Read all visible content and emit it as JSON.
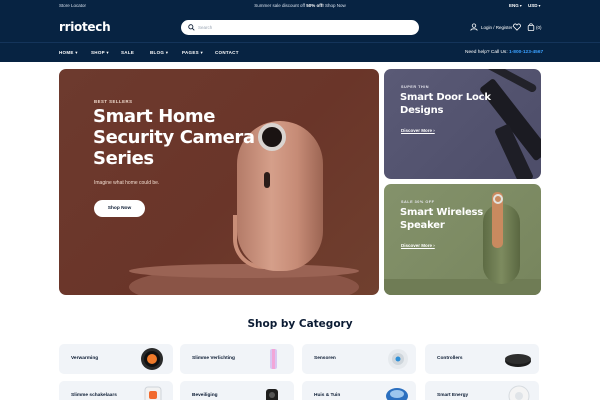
{
  "topbar": {
    "store_locator": "Store Locator",
    "promo_prefix": "Summer sale discount off ",
    "promo_bold": "50% off!",
    "promo_link": " Shop Now",
    "language": "ENG",
    "currency": "USD"
  },
  "header": {
    "logo": "rriotech",
    "search_placeholder": "Search",
    "login_label": "Login / Register",
    "cart_count": "(0)"
  },
  "nav": {
    "items": [
      "HOME",
      "SHOP",
      "SALE",
      "BLOG",
      "PAGES",
      "CONTACT"
    ],
    "help_label": "Need help? Call Us:",
    "help_phone": "1-800-123-4567"
  },
  "hero": {
    "eyebrow": "BEST SELLERS",
    "title": "Smart Home Security Camera Series",
    "subtitle": "Imagine what home could be.",
    "button": "Shop Now"
  },
  "side_banners": [
    {
      "eyebrow": "SUPER THIN",
      "title": "Smart Door Lock Designs",
      "link": "Discover More"
    },
    {
      "eyebrow": "SALE 30% OFF",
      "title": "Smart Wireless Speaker",
      "link": "Discover More"
    }
  ],
  "categories": {
    "title": "Shop by Category",
    "items": [
      {
        "label": "Verwarming",
        "icon": "thermostat-icon"
      },
      {
        "label": "Slimme Verlichting",
        "icon": "light-strip-icon"
      },
      {
        "label": "Sensoren",
        "icon": "sensor-icon"
      },
      {
        "label": "Controllers",
        "icon": "hub-icon"
      },
      {
        "label": "Slimme schakelaars",
        "icon": "switch-icon"
      },
      {
        "label": "Beveiliging",
        "icon": "camera-icon"
      },
      {
        "label": "Huis & Tuin",
        "icon": "robot-vacuum-icon"
      },
      {
        "label": "Smart Energy",
        "icon": "energy-meter-icon"
      }
    ]
  },
  "colors": {
    "navy": "#072342",
    "accent_blue": "#3aa0ff",
    "hero_brown": "#6d3a2e",
    "lock_purple": "#55556f",
    "speaker_green": "#7d8b60"
  }
}
